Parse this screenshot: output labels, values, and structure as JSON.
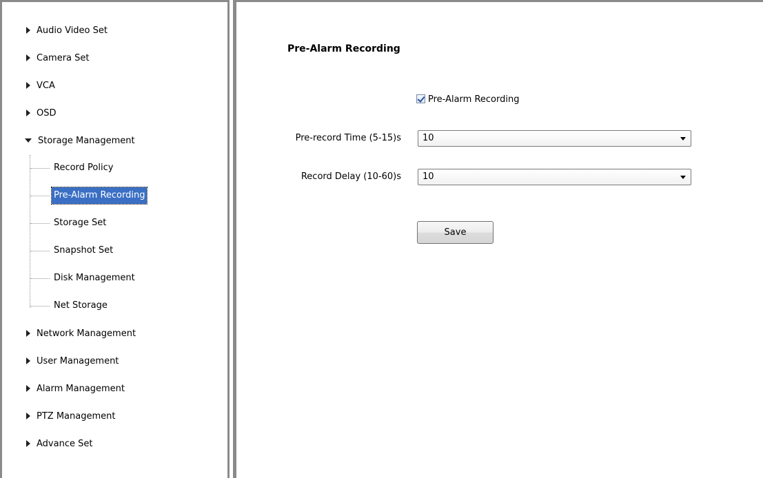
{
  "sidebar": {
    "items": [
      {
        "label": "Audio Video Set",
        "expanded": false
      },
      {
        "label": "Camera Set",
        "expanded": false
      },
      {
        "label": "VCA",
        "expanded": false
      },
      {
        "label": "OSD",
        "expanded": false
      },
      {
        "label": "Storage Management",
        "expanded": true
      },
      {
        "label": "Network Management",
        "expanded": false
      },
      {
        "label": "User Management",
        "expanded": false
      },
      {
        "label": "Alarm Management",
        "expanded": false
      },
      {
        "label": "PTZ Management",
        "expanded": false
      },
      {
        "label": "Advance Set",
        "expanded": false
      }
    ],
    "storage_children": [
      {
        "label": "Record Policy"
      },
      {
        "label": "Pre-Alarm Recording",
        "selected": true
      },
      {
        "label": "Storage Set"
      },
      {
        "label": "Snapshot Set"
      },
      {
        "label": "Disk Management"
      },
      {
        "label": "Net Storage"
      }
    ]
  },
  "main": {
    "title": "Pre-Alarm Recording",
    "enable_checkbox": {
      "label": "Pre-Alarm Recording",
      "checked": true
    },
    "pre_record_time": {
      "label": "Pre-record Time (5-15)s",
      "value": "10"
    },
    "record_delay": {
      "label": "Record Delay (10-60)s",
      "value": "10"
    },
    "save_label": "Save"
  },
  "colors": {
    "selection": "#3a6fc4",
    "frame": "#8a8a8a"
  }
}
